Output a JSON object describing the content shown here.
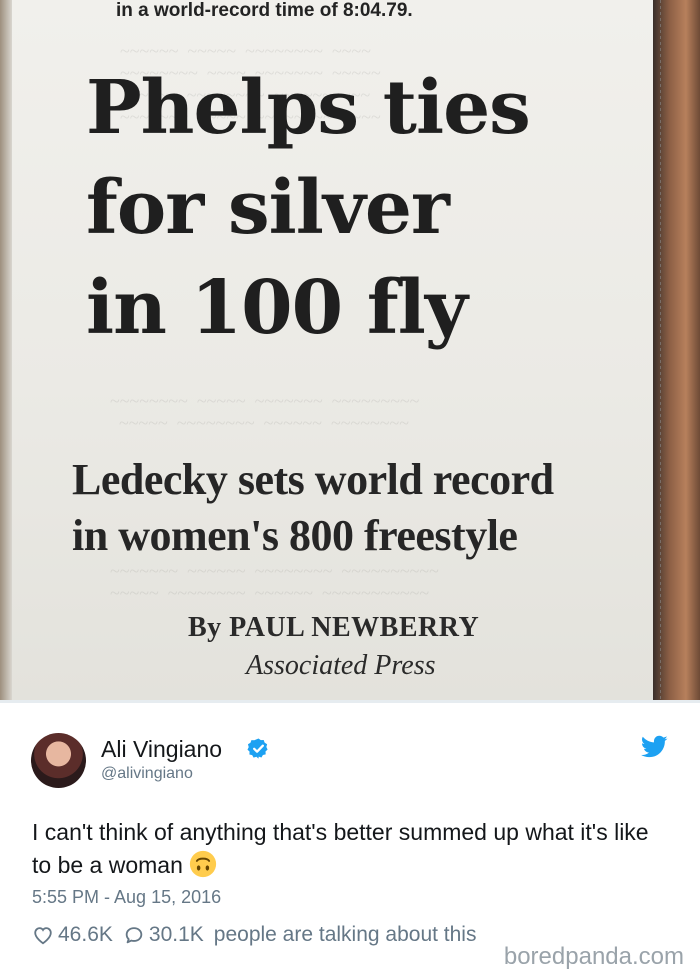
{
  "photo": {
    "kicker": "in a world-record time of 8:04.79.",
    "headline": [
      "Phelps ties",
      "for silver",
      "in 100 fly"
    ],
    "deck": [
      "Ledecky sets world record",
      "in women's 800 freestyle"
    ],
    "byline": "By PAUL NEWBERRY",
    "agency": "Associated Press"
  },
  "tweet": {
    "author_name": "Ali Vingiano",
    "handle": "@alivingiano",
    "verified": true,
    "text": "I can't think of anything that's better summed up what it's like to be a woman",
    "emoji": "upside-down-face",
    "timestamp": "5:55 PM - Aug 15, 2016",
    "likes": "46.6K",
    "replies": "30.1K",
    "talking_text": "people are talking about this",
    "icons": {
      "twitter": "twitter-bird-icon",
      "verified": "verified-badge-icon",
      "like": "heart-icon",
      "reply": "speech-bubble-icon"
    },
    "colors": {
      "twitter_blue": "#1da1f2",
      "text": "#14171a",
      "muted": "#657786"
    }
  },
  "watermark": "boredpanda.com"
}
